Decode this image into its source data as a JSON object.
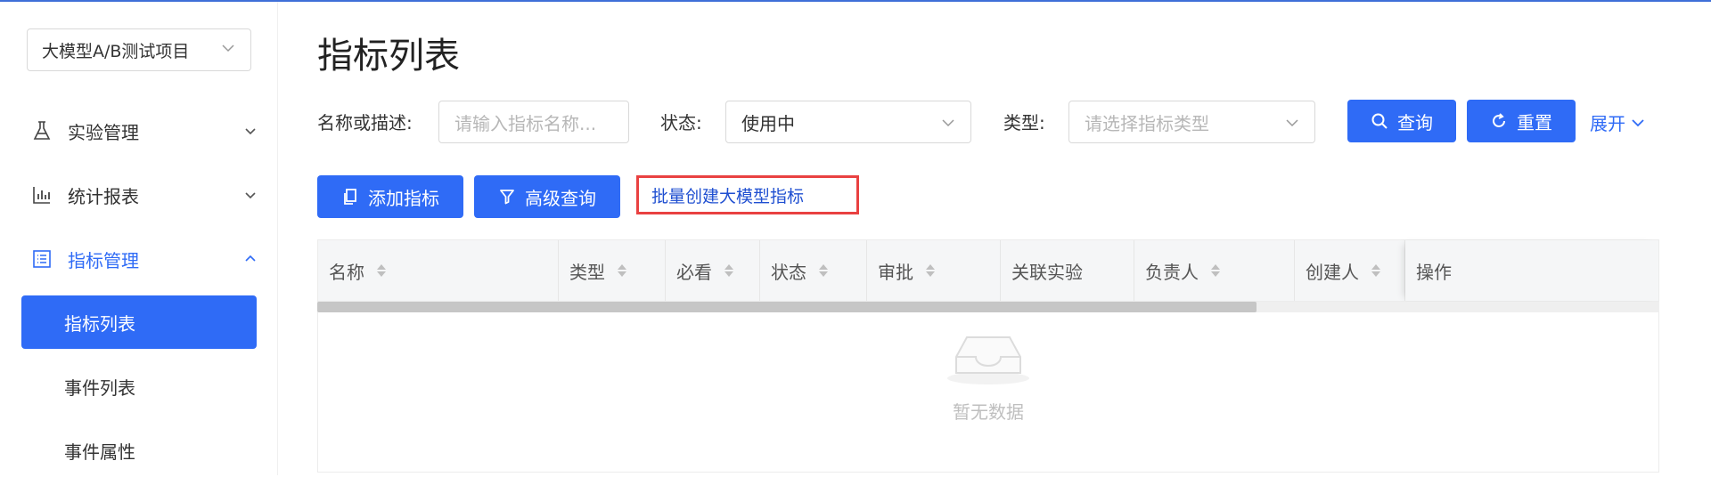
{
  "sidebar": {
    "project": "大模型A/B测试项目",
    "menu": [
      {
        "label": "实验管理",
        "icon": "flask-icon"
      },
      {
        "label": "统计报表",
        "icon": "bar-chart-icon"
      },
      {
        "label": "指标管理",
        "icon": "list-icon"
      }
    ],
    "submenu": [
      {
        "label": "指标列表"
      },
      {
        "label": "事件列表"
      },
      {
        "label": "事件属性"
      }
    ]
  },
  "page": {
    "title": "指标列表"
  },
  "filters": {
    "name_label": "名称或描述:",
    "name_placeholder": "请输入指标名称...",
    "status_label": "状态:",
    "status_value": "使用中",
    "type_label": "类型:",
    "type_placeholder": "请选择指标类型",
    "query_label": "查询",
    "reset_label": "重置",
    "expand_label": "展开"
  },
  "actions": {
    "add_label": "添加指标",
    "advanced_label": "高级查询",
    "batch_label": "批量创建大模型指标"
  },
  "table": {
    "columns": [
      "名称",
      "类型",
      "必看",
      "状态",
      "审批",
      "关联实验",
      "负责人",
      "创建人",
      "操作"
    ],
    "empty_text": "暂无数据",
    "scroll_fraction": 0.7
  },
  "colors": {
    "primary": "#2f6bf6",
    "highlight_border": "#e94141"
  }
}
